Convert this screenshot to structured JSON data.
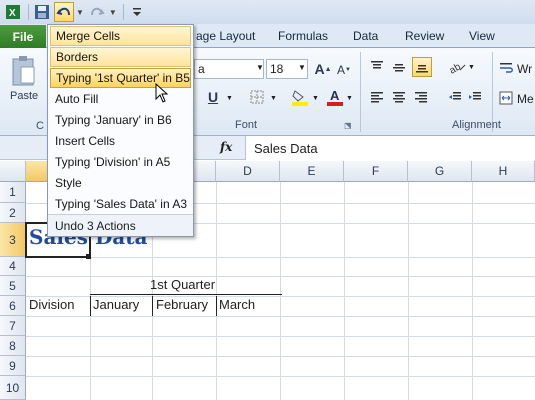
{
  "qat": {
    "icons": [
      "excel-logo-icon",
      "save-icon",
      "undo-icon",
      "redo-icon",
      "customize-icon"
    ]
  },
  "tabs": {
    "file": "File",
    "items": [
      "age Layout",
      "Formulas",
      "Data",
      "Review",
      "View"
    ]
  },
  "ribbon": {
    "paste_label": "Paste",
    "font_name": "a",
    "font_size": "18",
    "font_group": "Font",
    "alignment_group": "Alignment",
    "wrap_label": "Wr",
    "merge_label": "Me",
    "clipboard_fragment": "C"
  },
  "formula_bar": {
    "fx": "fx",
    "value": "Sales Data"
  },
  "columns": [
    "D",
    "E",
    "F",
    "G",
    "H"
  ],
  "rows": [
    "1",
    "2",
    "3",
    "4",
    "5",
    "6",
    "7",
    "8",
    "9",
    "10"
  ],
  "cells": {
    "a3": "Sales Data",
    "b5": "1st Quarter",
    "a6": "Division",
    "b6": "January",
    "c6": "February",
    "d6": "March"
  },
  "undo_menu": {
    "items": [
      "Merge Cells",
      "Borders",
      "Typing '1st Quarter' in B5",
      "Auto Fill",
      "Typing 'January' in B6",
      "Insert Cells",
      "Typing 'Division' in A5",
      "Style",
      "Typing 'Sales Data' in A3"
    ],
    "footer": "Undo 3 Actions"
  },
  "colors": {
    "file_tab": "#2e7d24",
    "title_text": "#1f4e9a",
    "highlight": "#ffd86b"
  }
}
